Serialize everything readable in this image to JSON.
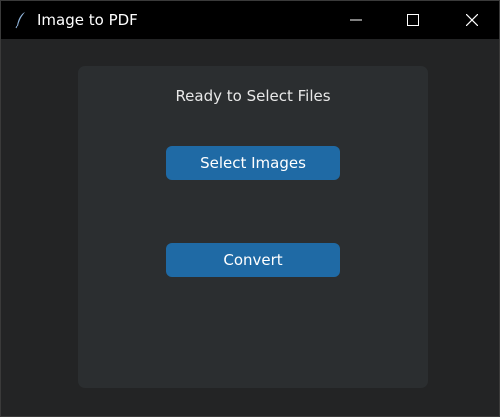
{
  "window": {
    "title": "Image to PDF",
    "controls": {
      "minimize_icon": "minimize-icon",
      "maximize_icon": "maximize-icon",
      "close_icon": "close-icon"
    }
  },
  "main": {
    "status_text": "Ready to Select Files",
    "select_button_label": "Select Images",
    "convert_button_label": "Convert"
  },
  "colors": {
    "titlebar": "#000000",
    "window_background": "#232425",
    "panel_background": "#2b2e30",
    "button_accent": "#1f6aa5",
    "text": "#ffffff"
  }
}
